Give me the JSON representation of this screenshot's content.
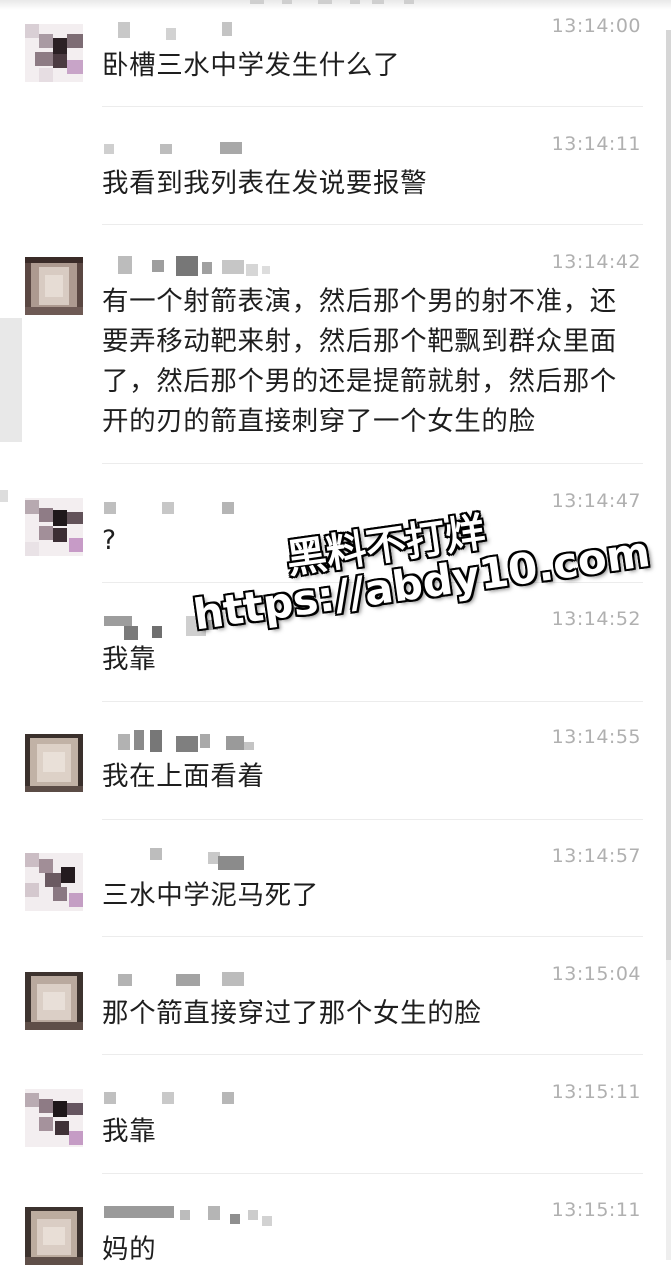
{
  "messages": [
    {
      "time": "13:14:00",
      "text": "卧槽三水中学发生什么了"
    },
    {
      "time": "13:14:11",
      "text": "我看到我列表在发说要报警"
    },
    {
      "time": "13:14:42",
      "text": "有一个射箭表演，然后那个男的射不准，还要弄移动靶来射，然后那个靶飘到群众里面了，然后那个男的还是提箭就射，然后那个开的刃的箭直接刺穿了一个女生的脸"
    },
    {
      "time": "13:14:47",
      "text": "?"
    },
    {
      "time": "13:14:52",
      "text": "我靠"
    },
    {
      "time": "13:14:55",
      "text": "我在上面看着"
    },
    {
      "time": "13:14:57",
      "text": "三水中学泥马死了"
    },
    {
      "time": "13:15:04",
      "text": "那个箭直接穿过了那个女生的脸"
    },
    {
      "time": "13:15:11",
      "text": "我靠"
    },
    {
      "time": "13:15:11",
      "text": "妈的"
    }
  ],
  "watermark": {
    "line1": "黑料不打烊",
    "line2": "https://abdy10.com"
  },
  "colors": {
    "background": "#ffffff",
    "text": "#1e1e1e",
    "time": "#b0b0b0",
    "divider": "#ececec"
  }
}
